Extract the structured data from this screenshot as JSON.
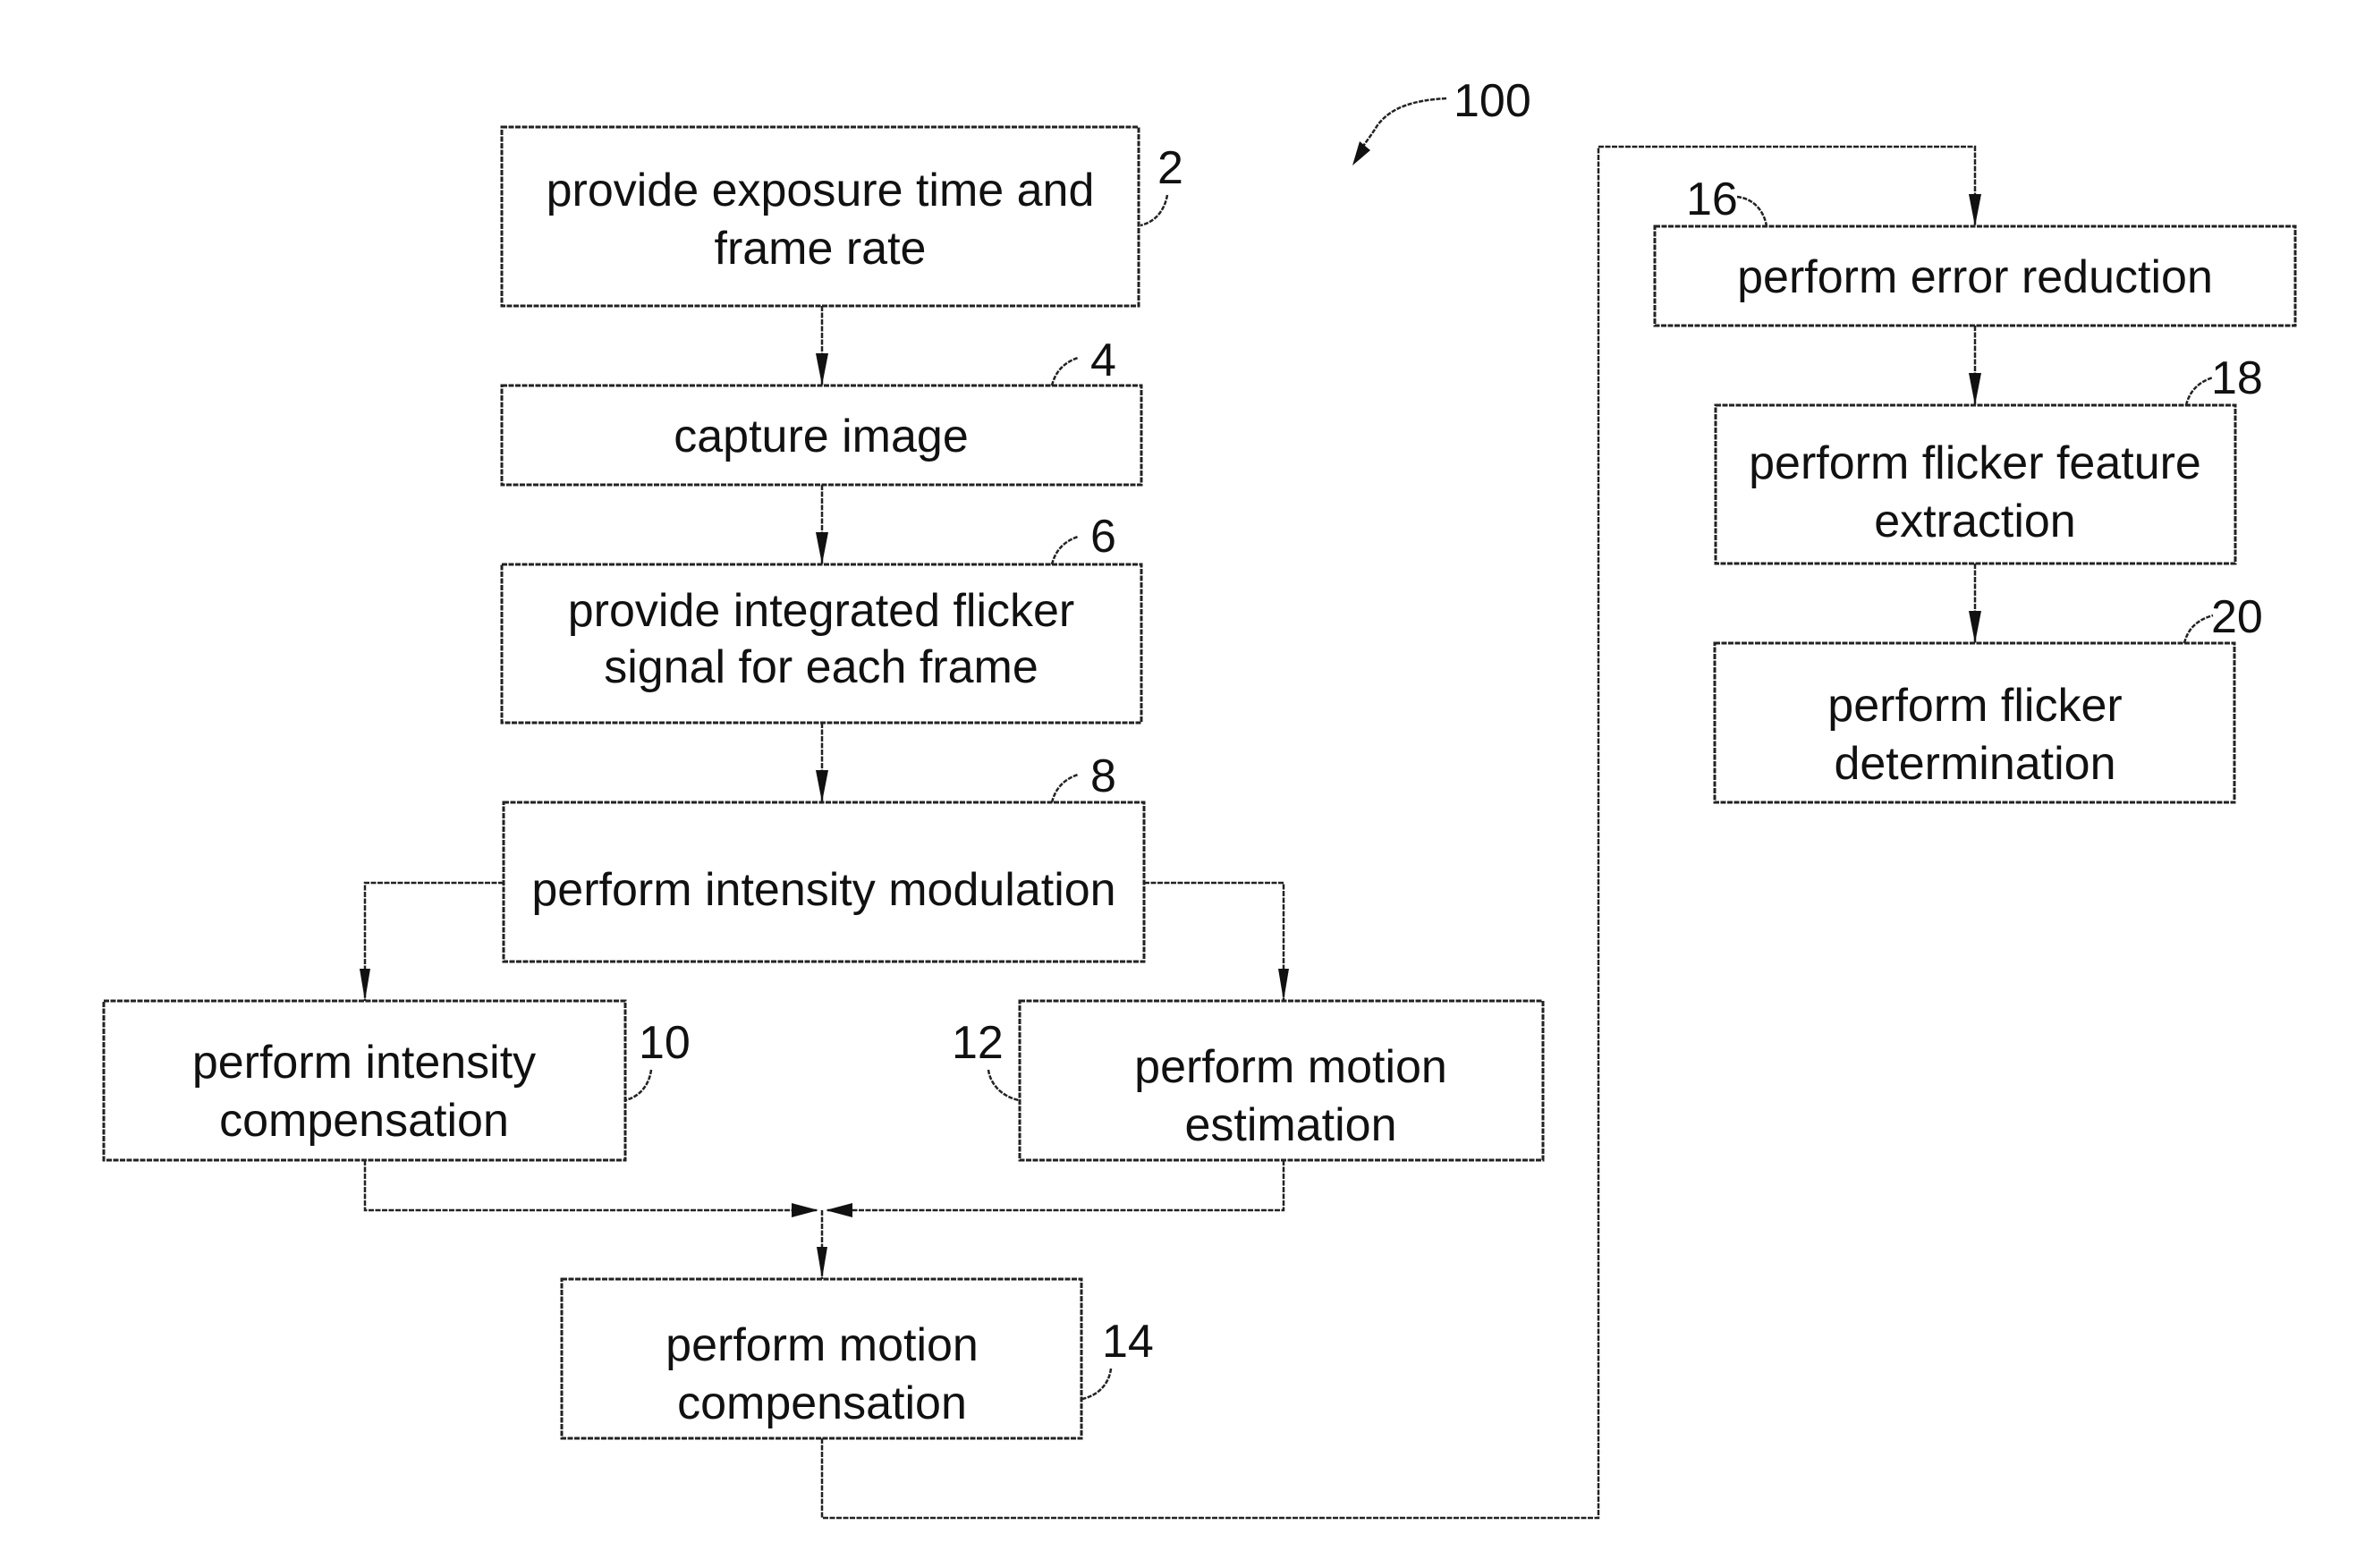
{
  "figure": {
    "reference_numeral": "100",
    "steps": [
      {
        "id": "2",
        "lines": [
          "provide exposure time and",
          "frame rate"
        ]
      },
      {
        "id": "4",
        "lines": [
          "capture image"
        ]
      },
      {
        "id": "6",
        "lines": [
          "provide integrated flicker",
          "signal for each frame"
        ]
      },
      {
        "id": "8",
        "lines": [
          "perform intensity modulation"
        ]
      },
      {
        "id": "10",
        "lines": [
          "perform intensity",
          "compensation"
        ]
      },
      {
        "id": "12",
        "lines": [
          "perform motion",
          "estimation"
        ]
      },
      {
        "id": "14",
        "lines": [
          "perform motion",
          "compensation"
        ]
      },
      {
        "id": "16",
        "lines": [
          "perform error reduction"
        ]
      },
      {
        "id": "18",
        "lines": [
          "perform flicker feature",
          "extraction"
        ]
      },
      {
        "id": "20",
        "lines": [
          "perform flicker",
          "determination"
        ]
      }
    ],
    "flow": [
      [
        "2",
        "4"
      ],
      [
        "4",
        "6"
      ],
      [
        "6",
        "8"
      ],
      [
        "8",
        "10"
      ],
      [
        "8",
        "12"
      ],
      [
        "10",
        "14"
      ],
      [
        "12",
        "14"
      ],
      [
        "14",
        "16"
      ],
      [
        "16",
        "18"
      ],
      [
        "18",
        "20"
      ]
    ]
  }
}
